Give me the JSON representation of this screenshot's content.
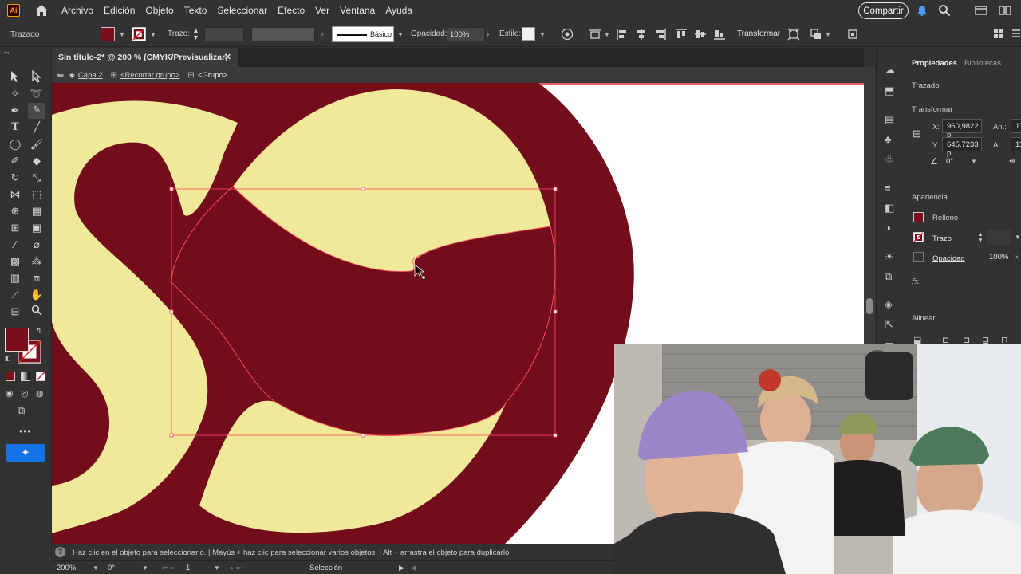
{
  "app": {
    "logo_text": "Ai",
    "menu": [
      "Archivo",
      "Edición",
      "Objeto",
      "Texto",
      "Seleccionar",
      "Efecto",
      "Ver",
      "Ventana",
      "Ayuda"
    ],
    "share_label": "Compartir"
  },
  "controlbar": {
    "object_type": "Trazado",
    "stroke_label": "Trazo:",
    "stroke_style": "Básico",
    "opacity_label": "Opacidad:",
    "opacity_value": "100%",
    "style_label": "Estilo:",
    "transform_label": "Transformar",
    "fill_color": "#7a0e1c"
  },
  "document": {
    "tab_title": "Sin título-2* @ 200 % (CMYK/Previsualizar)",
    "breadcrumb": [
      "Capa 2",
      "<Recortar grupo>",
      "<Grupo>"
    ]
  },
  "properties": {
    "tabs": [
      "Propiedades",
      "Bibliotecas"
    ],
    "object_type": "Trazado",
    "transform_title": "Transformar",
    "x_label": "X:",
    "x_value": "960,9822 p",
    "y_label": "Y:",
    "y_value": "645,7233 p",
    "w_label": "An.:",
    "w_value": "17",
    "h_label": "Al.:",
    "h_value": "11",
    "rotation_value": "0°",
    "appearance_title": "Apariencia",
    "fill_label": "Relleno",
    "stroke_label": "Trazo",
    "opacity_label": "Opacidad",
    "opacity_value": "100%",
    "fx_label": "fx.",
    "align_title": "Alinear"
  },
  "hint": {
    "text": "Haz clic en el objeto para seleccionarlo.  |  Mayús + haz clic para seleccionar varios objetos.  |  Alt + arrastra el objeto para duplicarlo."
  },
  "status": {
    "zoom": "200%",
    "rotation": "0°",
    "artboard": "1",
    "tool": "Selección"
  },
  "colors": {
    "burgundy": "#730c1b",
    "cream": "#f0e99a",
    "selection": "#ff4f5e"
  }
}
